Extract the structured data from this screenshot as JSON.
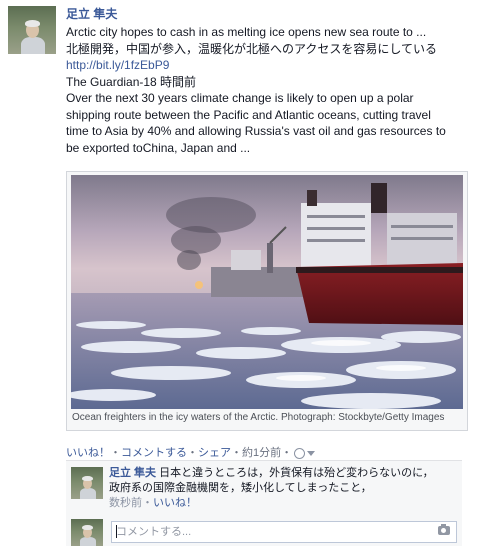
{
  "post": {
    "author": "足立 隼夫",
    "headline": "Arctic city hopes to cash in as melting ice opens new sea route to ...",
    "japanese_summary": "北極開発，中国が参入，温暖化が北極へのアクセスを容易にしている",
    "link": "http://bit.ly/1fzEbP9",
    "source_time": "The Guardian-18 時間前",
    "excerpt_1": "Over the next 30 years climate change is likely to open up a polar",
    "excerpt_2": "shipping route between the Pacific and Atlantic oceans, cutting travel",
    "excerpt_3": "time to Asia by 40% and allowing Russia's vast oil and gas resources to",
    "excerpt_4": "be exported toChina, Japan and ..."
  },
  "media": {
    "caption": "Ocean freighters in the icy waters of the Arctic. Photograph: Stockbyte/Getty Images"
  },
  "actions": {
    "like": "いいね！",
    "comment": "コメントする",
    "share": "シェア",
    "time": "約1分前",
    "sep": "・"
  },
  "comment": {
    "author": "足立 隼夫",
    "line1": "日本と違うところは，外貨保有は殆ど変わらないのに，",
    "line2": "政府系の国際金融機関を，矮小化してしまったこと，",
    "time": "数秒前",
    "like": "いいね！"
  },
  "compose": {
    "placeholder": "コメントする..."
  },
  "colors": {
    "link": "#3b5998",
    "meta": "#6a7180"
  }
}
